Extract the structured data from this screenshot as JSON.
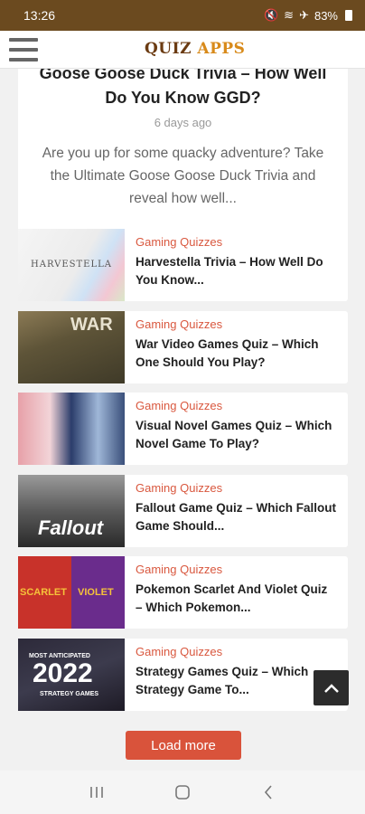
{
  "status": {
    "time": "13:26",
    "battery": "83%"
  },
  "header": {
    "logo_text": "QUIZ",
    "logo_accent": "APPS"
  },
  "featured": {
    "title": "Goose Goose Duck Trivia – How Well Do You Know GGD?",
    "date": "6 days ago",
    "excerpt": "Are you up for some quacky adventure? Take the Ultimate Goose Goose Duck Trivia and reveal how well..."
  },
  "cards": [
    {
      "category": "Gaming Quizzes",
      "title": "Harvestella Trivia – How Well Do You Know...",
      "thumb_text": "HARVESTELLA"
    },
    {
      "category": "Gaming Quizzes",
      "title": "War Video Games Quiz – Which One Should You Play?",
      "thumb_text": "WAR"
    },
    {
      "category": "Gaming Quizzes",
      "title": "Visual Novel Games Quiz – Which Novel Game To Play?",
      "thumb_text": ""
    },
    {
      "category": "Gaming Quizzes",
      "title": "Fallout Game Quiz – Which Fallout Game Should...",
      "thumb_text": "Fallout"
    },
    {
      "category": "Gaming Quizzes",
      "title": "Pokemon Scarlet And Violet Quiz – Which Pokemon...",
      "thumb_text": "SCARLET",
      "thumb_text2": "VIOLET"
    },
    {
      "category": "Gaming Quizzes",
      "title": "Strategy Games Quiz – Which Strategy Game To...",
      "thumb_text": "2022",
      "thumb_small_top": "MOST ANTICIPATED",
      "thumb_small_bottom": "STRATEGY GAMES"
    }
  ],
  "load_more": "Load more"
}
